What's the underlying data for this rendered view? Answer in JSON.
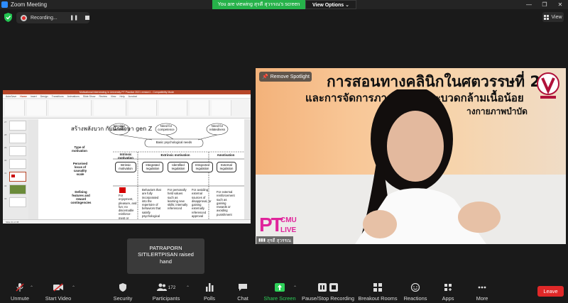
{
  "window": {
    "title": "Zoom Meeting",
    "banner_text": "You are viewing สุรดี สุวรรณ's screen",
    "view_options": "View Options",
    "view_button": "View"
  },
  "recording": {
    "label": "Recording..."
  },
  "ppt": {
    "window_title": "Motivational Interviewing in University PT Practice 2021 version1 - Compatibility Mode",
    "tabs": [
      "AutoSave",
      "Home",
      "Insert",
      "Design",
      "Transitions",
      "Animations",
      "Slide Show",
      "Review",
      "View",
      "Help",
      "Acrobat"
    ],
    "slide_numbers": [
      "27",
      "28",
      "29",
      "30",
      "31",
      "32",
      "33"
    ],
    "status": "Slide 31 of 38",
    "slide": {
      "title": "สร้างพลังบวก กับนักศึกษา gen Z",
      "need_autonomy": "Need for autonomy",
      "need_competence": "Need for competence",
      "need_relatedness": "Need for relatedness",
      "basic_needs": "Basic psychological needs",
      "type_motivation": "Type of motivation",
      "intrinsic_motivation": "Intrinsic motivation",
      "extrinsic_motivation": "Extrinsic motivation",
      "amotivation_header": "Amotivation",
      "perceived_locus": "Perceived locus of causality scale",
      "intrinsic": "Intrinsic motivation",
      "integrated": "Integrated regulation",
      "identified": "Identified regulation",
      "introjected": "Introjected regulation",
      "external": "External regulation",
      "amotivation": "Amotivation",
      "defining": "Defining features and reward contingencies",
      "col_intrinsic": "For enjoyment, pleasure, and fun; no discernable reinforce- ment or reward",
      "col_integrated": "Behaviors that are fully incorporated into the repertoire of behaviors that satisfy psychological",
      "col_identified": "For personally held values such as learning new skills; internally referenced",
      "col_introjected": "For avoiding external sources of disapproval, or gaining externally referenced approval",
      "col_external": "For external reinforcement such as gaining rewards or avoiding punishment",
      "col_amotivation": "Lack of intentionality and personal causation"
    }
  },
  "video": {
    "remove_spotlight": "Remove Spotlight",
    "heading_line1": "การสอนทางคลินิกในศตวรรษที่ 21",
    "heading_line2": "และการจัดการภาวะเปลี้ยและบวดกล้ามเนื้อน้อย",
    "heading_line3": "างกายภาพบำบัด",
    "pt": "PT",
    "cmu": "CMU",
    "live": "LIVE",
    "participant_name": "สุรดี สุวรรณ"
  },
  "toast": {
    "line1": "PATRAPORN",
    "line2": "SITILERTPISAN raised",
    "line3": "hand"
  },
  "toolbar": {
    "unmute": "Unmute",
    "start_video": "Start Video",
    "security": "Security",
    "participants": "Participants",
    "participants_count": "172",
    "polls": "Polls",
    "chat": "Chat",
    "share_screen": "Share Screen",
    "pause_stop_recording": "Pause/Stop Recording",
    "breakout_rooms": "Breakout Rooms",
    "reactions": "Reactions",
    "apps": "Apps",
    "more": "More",
    "leave": "Leave"
  },
  "colors": {
    "accent_green": "#2ed159",
    "leave_red": "#e02828",
    "ppt_red": "#b7472a",
    "pt_pink": "#e0249b"
  }
}
